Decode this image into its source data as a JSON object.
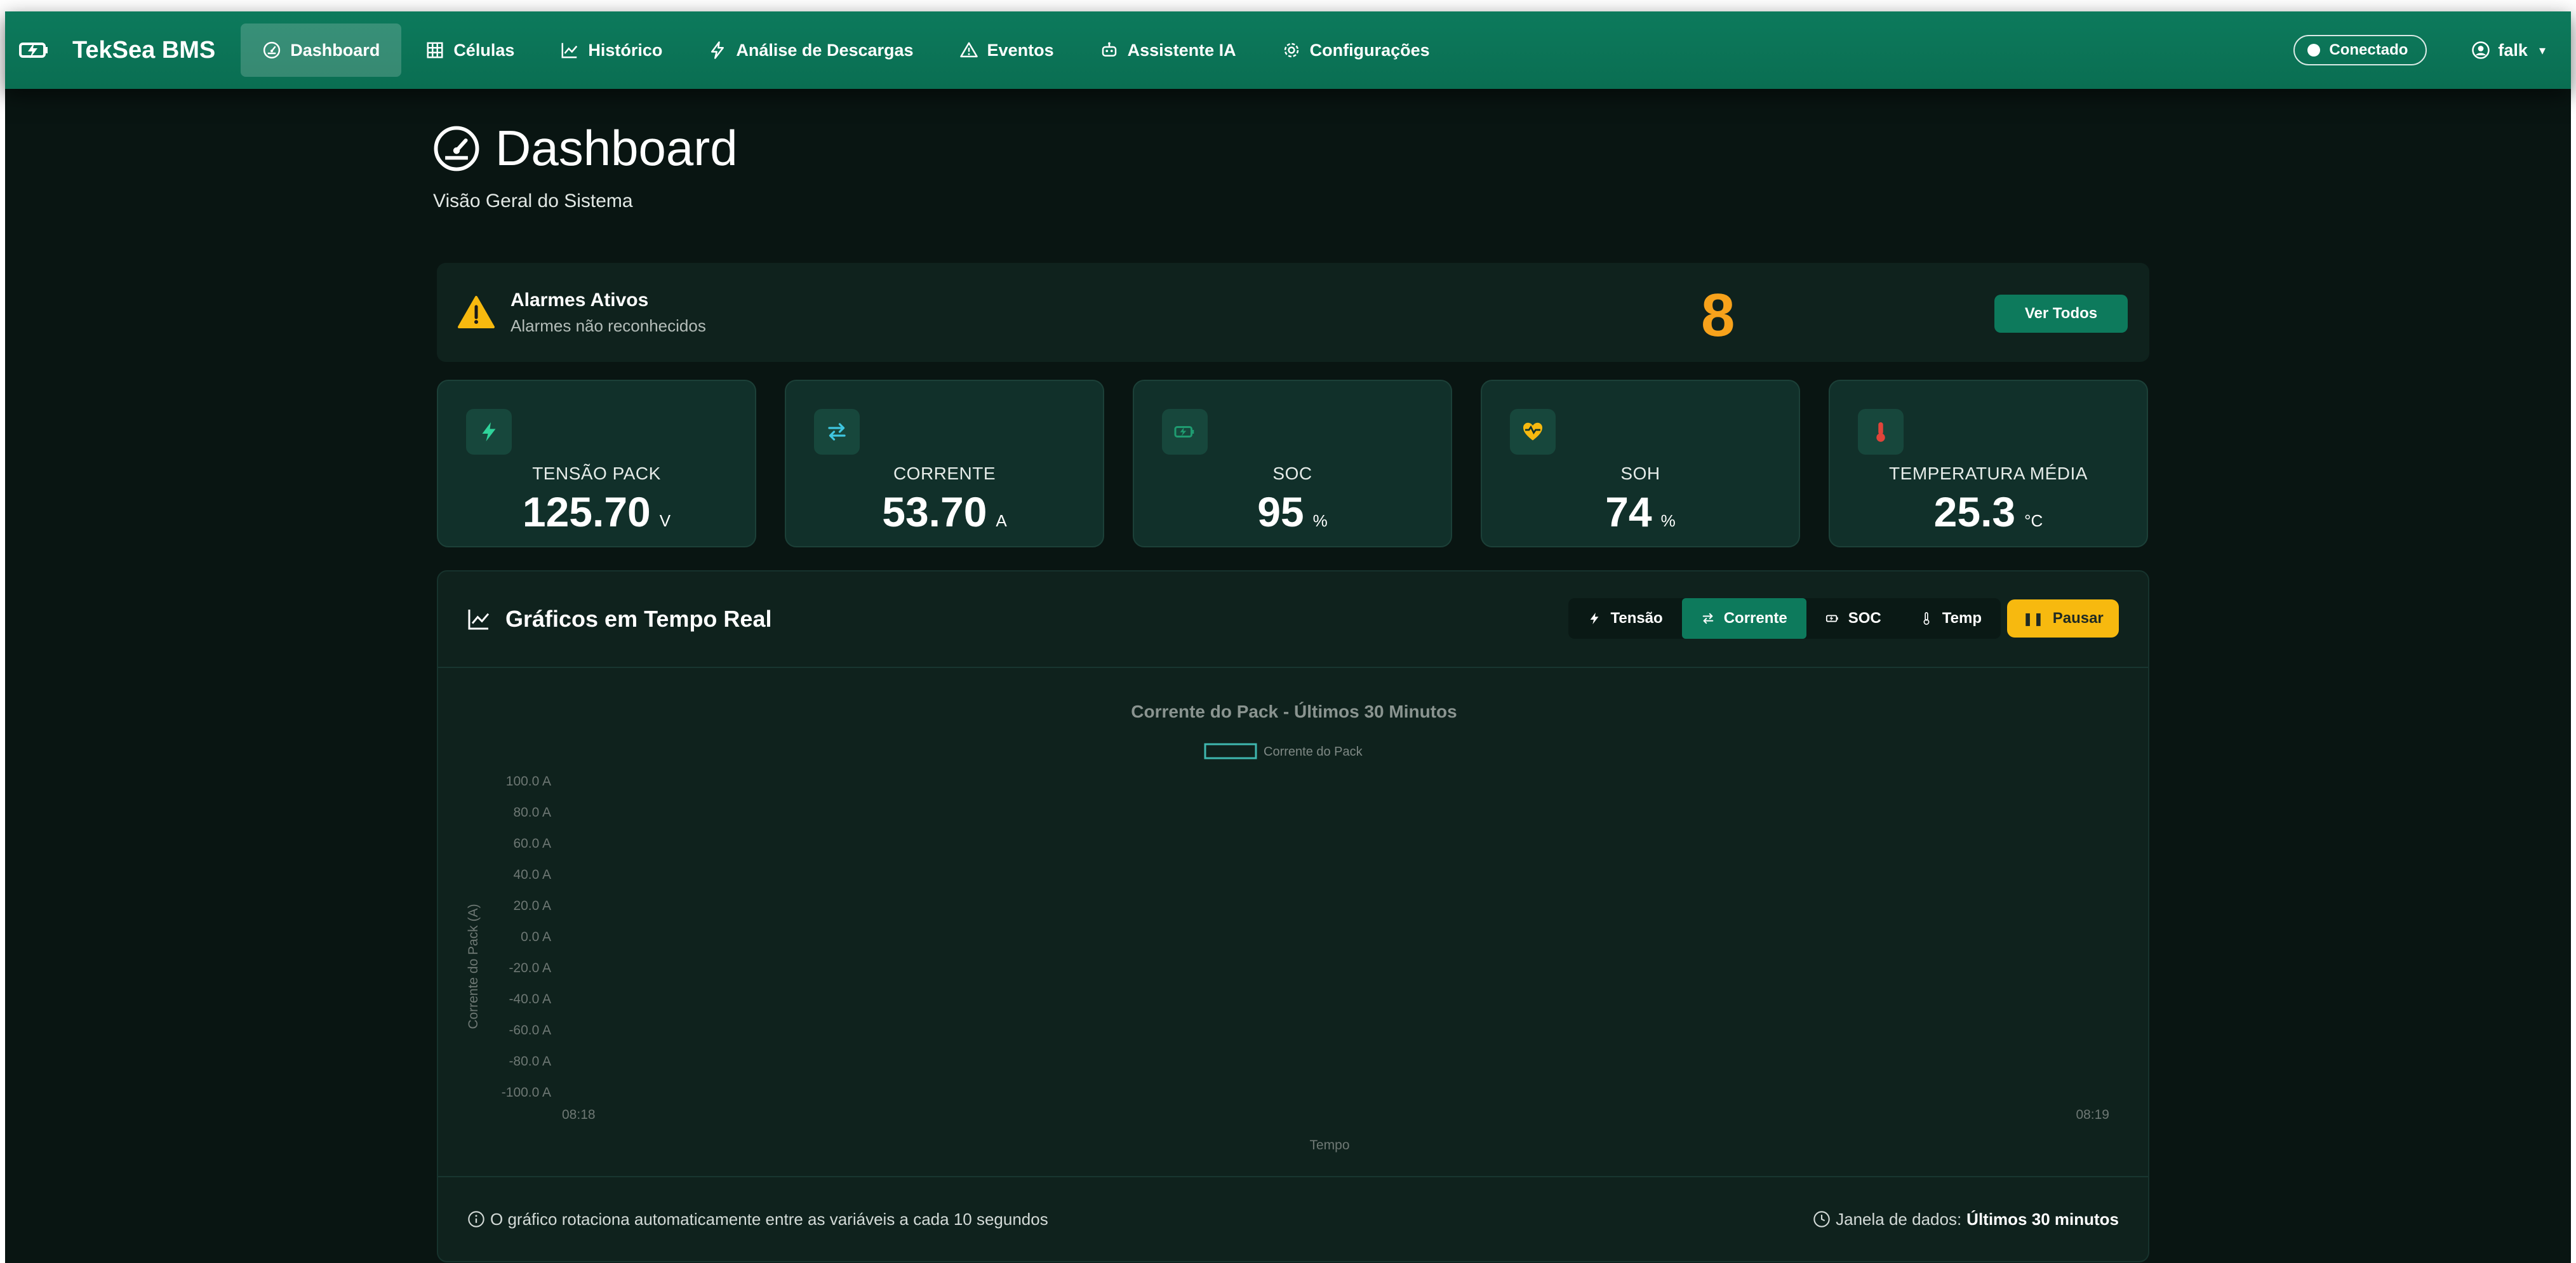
{
  "app": {
    "brand": "TekSea BMS",
    "accent_color": "#0d7a5c"
  },
  "nav": {
    "items": [
      {
        "label": "Dashboard",
        "icon": "gauge-icon",
        "active": true
      },
      {
        "label": "Células",
        "icon": "grid-icon"
      },
      {
        "label": "Histórico",
        "icon": "line-chart-icon"
      },
      {
        "label": "Análise de Descargas",
        "icon": "lightning-icon"
      },
      {
        "label": "Eventos",
        "icon": "warning-icon"
      },
      {
        "label": "Assistente IA",
        "icon": "robot-icon"
      },
      {
        "label": "Configurações",
        "icon": "gear-icon"
      }
    ],
    "status": "Conectado",
    "user": "falk"
  },
  "page": {
    "title": "Dashboard",
    "subtitle": "Visão Geral do Sistema"
  },
  "alarms": {
    "title": "Alarmes Ativos",
    "subtitle": "Alarmes não reconhecidos",
    "count": "8",
    "button": "Ver Todos",
    "count_color": "#f7a21b"
  },
  "stats": [
    {
      "label": "TENSÃO PACK",
      "value": "125.70",
      "unit": "V",
      "icon": "lightning-icon"
    },
    {
      "label": "CORRENTE",
      "value": "53.70",
      "unit": "A",
      "icon": "arrows-exchange-icon"
    },
    {
      "label": "SOC",
      "value": "95",
      "unit": "%",
      "icon": "battery-charging-icon"
    },
    {
      "label": "SOH",
      "value": "74",
      "unit": "%",
      "icon": "heart-pulse-icon"
    },
    {
      "label": "TEMPERATURA MÉDIA",
      "value": "25.3",
      "unit": "°C",
      "icon": "thermometer-icon"
    }
  ],
  "realtime": {
    "title": "Gráficos em Tempo Real",
    "tabs": [
      {
        "label": "Tensão",
        "icon": "lightning-icon"
      },
      {
        "label": "Corrente",
        "icon": "arrows-exchange-icon",
        "active": true
      },
      {
        "label": "SOC",
        "icon": "battery-charging-icon"
      },
      {
        "label": "Temp",
        "icon": "thermometer-icon"
      }
    ],
    "pause_label": "Pausar",
    "footer_note": "O gráfico rotaciona automaticamente entre as variáveis a cada 10 segundos",
    "window_label": "Janela de dados:",
    "window_value": "Últimos 30 minutos"
  },
  "chart_data": {
    "type": "line",
    "title": "Corrente do Pack - Últimos 30 Minutos",
    "series": [
      {
        "name": "Corrente do Pack",
        "values": []
      }
    ],
    "x": [],
    "xlabel": "Tempo",
    "ylabel": "Corrente do Pack (A)",
    "ylim": [
      -100,
      100
    ],
    "y_ticks": [
      "100.0 A",
      "80.0 A",
      "60.0 A",
      "40.0 A",
      "20.0 A",
      "0.0 A",
      "-20.0 A",
      "-40.0 A",
      "-60.0 A",
      "-80.0 A",
      "-100.0 A"
    ],
    "x_ticks": [
      "08:18",
      "08:19"
    ],
    "legend": "top-center",
    "grid": false,
    "series_color": "#3fb8b0"
  }
}
